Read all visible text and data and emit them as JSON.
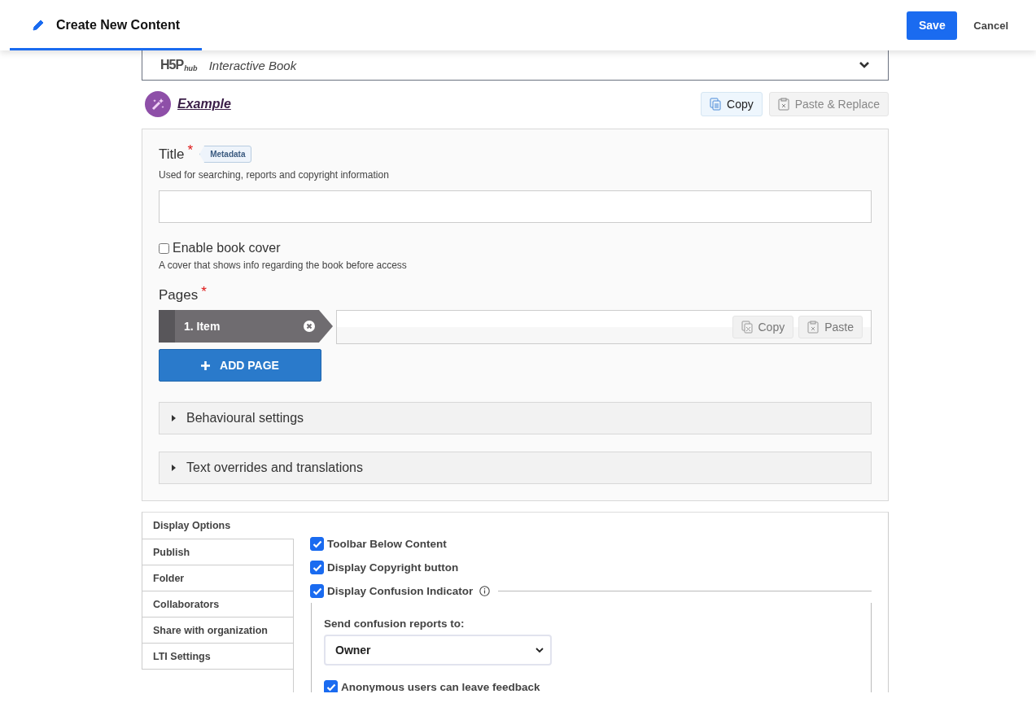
{
  "header": {
    "title": "Create New Content",
    "save": "Save",
    "cancel": "Cancel"
  },
  "hub": {
    "logo": "H5P",
    "logo_sub": "hub",
    "content_type": "Interactive Book",
    "expanded": false
  },
  "example": {
    "title": "Example",
    "copy": "Copy",
    "paste": "Paste & Replace",
    "paste_disabled": true
  },
  "form": {
    "title_label": "Title",
    "required": "*",
    "metadata": "Metadata",
    "title_description": "Used for searching, reports and copyright information",
    "cover": {
      "label": "Enable book cover",
      "checked": false,
      "description": "A cover that shows info regarding the book before access"
    },
    "pages_label": "Pages",
    "pages_required": "*",
    "pages": [
      {
        "label": "1. Item",
        "selected": true
      }
    ],
    "page_copy": "Copy",
    "page_paste": "Paste",
    "add_page": "ADD PAGE",
    "sections": [
      {
        "label": "Behavioural settings",
        "expanded": false
      },
      {
        "label": "Text overrides and translations",
        "expanded": false
      }
    ]
  },
  "settings_tabs": [
    {
      "label": "Display Options",
      "selected": true
    },
    {
      "label": "Publish",
      "selected": false
    },
    {
      "label": "Folder",
      "selected": false
    },
    {
      "label": "Collaborators",
      "selected": false
    },
    {
      "label": "Share with organization",
      "selected": false
    },
    {
      "label": "LTI Settings",
      "selected": false
    }
  ],
  "display_options": [
    {
      "kind": "plain",
      "label": "Toolbar Below Content",
      "checked": true
    },
    {
      "kind": "plain",
      "label": "Display Copyright button",
      "checked": true
    },
    {
      "kind": "group",
      "label": "Display Confusion Indicator",
      "checked": true
    }
  ],
  "confusion": {
    "label": "Send confusion reports to:",
    "value": "Owner",
    "anonymous_label": "Anonymous users can leave feedback",
    "anonymous_checked": true
  }
}
